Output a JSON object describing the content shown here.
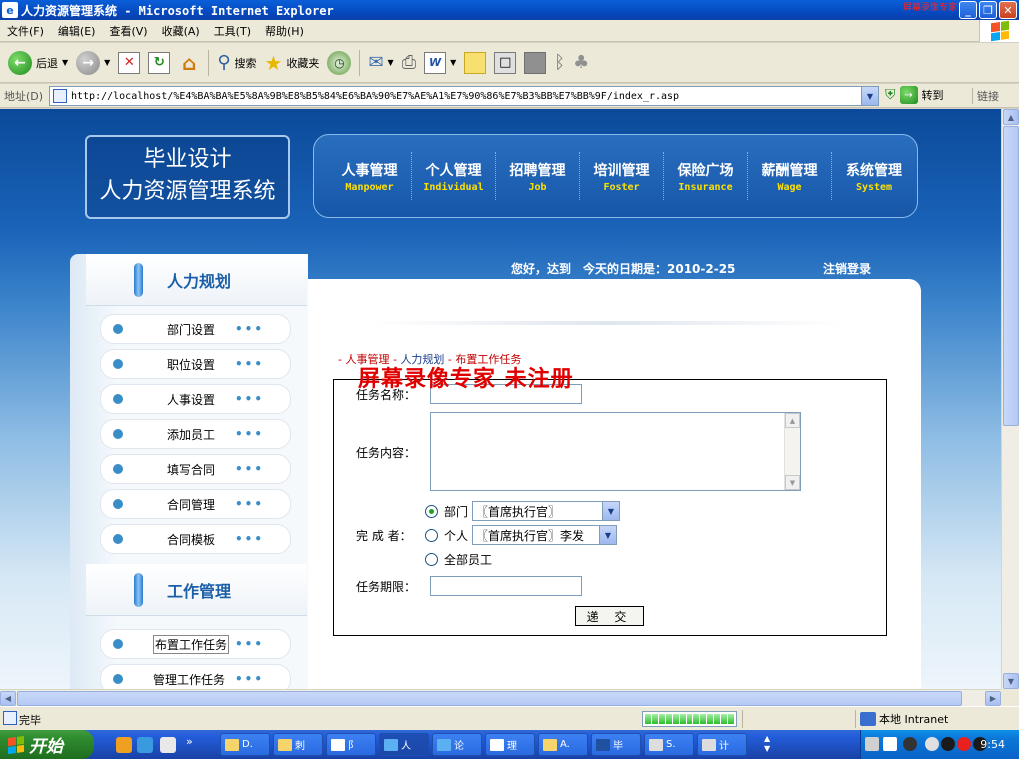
{
  "window": {
    "title": "人力资源管理系统 - Microsoft Internet Explorer",
    "watermark_small": "屏幕录像专家"
  },
  "menubar": {
    "items": [
      "文件(F)",
      "编辑(E)",
      "查看(V)",
      "收藏(A)",
      "工具(T)",
      "帮助(H)"
    ]
  },
  "toolbar": {
    "back": "后退",
    "search": "搜索",
    "favorites": "收藏夹"
  },
  "addressbar": {
    "label": "地址(D)",
    "url": "http://localhost/%E4%BA%BA%E5%8A%9B%E8%B5%84%E6%BA%90%E7%AE%A1%E7%90%86%E7%B3%BB%E7%BB%9F/index_r.asp",
    "go": "转到",
    "links": "链接"
  },
  "site": {
    "logo_line1": "毕业设计",
    "logo_line2": "人力资源管理系统",
    "nav": [
      {
        "cn": "人事管理",
        "en": "Manpower"
      },
      {
        "cn": "个人管理",
        "en": "Individual"
      },
      {
        "cn": "招聘管理",
        "en": "Job"
      },
      {
        "cn": "培训管理",
        "en": "Foster"
      },
      {
        "cn": "保险广场",
        "en": "Insurance"
      },
      {
        "cn": "薪酬管理",
        "en": "Wage"
      },
      {
        "cn": "系统管理",
        "en": "System"
      }
    ],
    "greeting": "您好，达到　今天的日期是：2010-2-25",
    "logout": "注销登录"
  },
  "sidebar": {
    "section1_title": "人力规划",
    "section1_items": [
      "部门设置",
      "职位设置",
      "人事设置",
      "添加员工",
      "填写合同",
      "合同管理",
      "合同模板"
    ],
    "section2_title": "工作管理",
    "section2_items": [
      "布置工作任务",
      "管理工作任务"
    ],
    "dots": "•••"
  },
  "breadcrumb": {
    "prefix": "- ",
    "part1": "人事管理",
    "sep": " - ",
    "part2": "人力规划",
    "part3": "布置工作任务"
  },
  "recorder_watermark": "屏幕录像专家  未注册",
  "form": {
    "task_name_label": "任务名称：",
    "task_name_value": "",
    "task_content_label": "任务内容：",
    "task_content_value": "",
    "assignee_label": "完 成 者：",
    "radio_dept": "部门",
    "radio_person": "个人",
    "radio_all": "全部员工",
    "dept_select": "〖首席执行官〗",
    "person_select": "〖首席执行官〗李发",
    "deadline_label": "任务期限：",
    "deadline_value": "",
    "submit": "递 交",
    "selected_radio": "dept"
  },
  "statusbar": {
    "text": "完毕",
    "zone": "本地 Intranet"
  },
  "taskbar": {
    "start": "开始",
    "tasks": [
      "D.",
      "刺",
      "阝",
      "人",
      "论",
      "理",
      "A.",
      "毕",
      "S.",
      "计"
    ],
    "clock": "9:54"
  }
}
